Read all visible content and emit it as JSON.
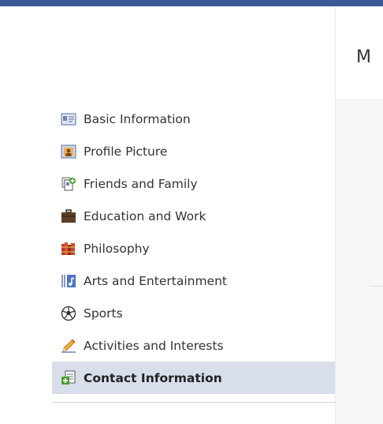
{
  "main": {
    "heading_fragment": "M"
  },
  "sidebar": {
    "items": [
      {
        "label": "Basic Information",
        "icon": "id-card-icon",
        "selected": false
      },
      {
        "label": "Profile Picture",
        "icon": "profile-picture-icon",
        "selected": false
      },
      {
        "label": "Friends and Family",
        "icon": "friends-family-icon",
        "selected": false
      },
      {
        "label": "Education and Work",
        "icon": "briefcase-icon",
        "selected": false
      },
      {
        "label": "Philosophy",
        "icon": "books-icon",
        "selected": false
      },
      {
        "label": "Arts and Entertainment",
        "icon": "music-icon",
        "selected": false
      },
      {
        "label": "Sports",
        "icon": "soccer-ball-icon",
        "selected": false
      },
      {
        "label": "Activities and Interests",
        "icon": "pencil-icon",
        "selected": false
      },
      {
        "label": "Contact Information",
        "icon": "contact-card-icon",
        "selected": true
      }
    ]
  },
  "colors": {
    "header": "#3b5998",
    "selected_bg": "#d8dfea"
  }
}
